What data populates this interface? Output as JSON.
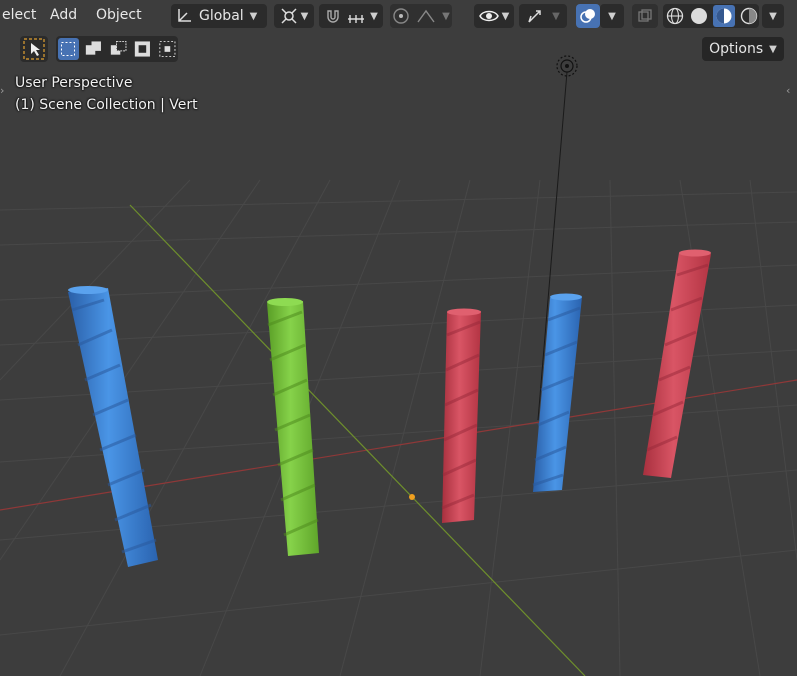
{
  "header": {
    "menu": [
      "elect",
      "Add",
      "Object"
    ],
    "transform_orientation": "Global",
    "options_label": "Options"
  },
  "viewport": {
    "view_name": "User Perspective",
    "collection_info": "(1) Scene Collection | Vert"
  },
  "colors": {
    "background": "#3d3d3d",
    "grid": "#4a4a4a",
    "x_axis": "#9c3a3a",
    "y_axis": "#6c8f2a",
    "object_blue": "#3a7fd0",
    "object_green": "#74c03a",
    "object_red": "#c9404f",
    "accent": "#4772b3"
  },
  "objects": [
    {
      "name": "blue-twisted-column-left",
      "color": "blue"
    },
    {
      "name": "green-twisted-column",
      "color": "green"
    },
    {
      "name": "red-twisted-column-center",
      "color": "red"
    },
    {
      "name": "blue-twisted-column-right",
      "color": "blue"
    },
    {
      "name": "red-twisted-column-right",
      "color": "red"
    }
  ]
}
